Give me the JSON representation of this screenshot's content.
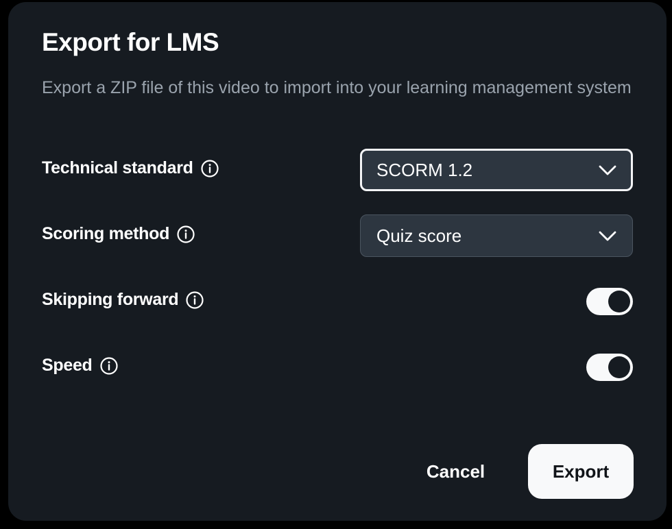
{
  "dialog": {
    "title": "Export for LMS",
    "description": "Export a ZIP file of this video to import into your learning management system"
  },
  "fields": {
    "technical_standard": {
      "label": "Technical standard",
      "icon": "info-icon",
      "value": "SCORM 1.2",
      "focused": true
    },
    "scoring_method": {
      "label": "Scoring method",
      "icon": "info-icon",
      "value": "Quiz score"
    },
    "skipping_forward": {
      "label": "Skipping forward",
      "icon": "info-icon",
      "enabled": true
    },
    "speed": {
      "label": "Speed",
      "icon": "info-icon",
      "enabled": true
    }
  },
  "actions": {
    "cancel_label": "Cancel",
    "export_label": "Export"
  },
  "colors": {
    "dialog_background": "#161b21",
    "select_background": "#2d3640",
    "muted_text": "#9aa3ad",
    "button_light": "#f8f9fa"
  }
}
